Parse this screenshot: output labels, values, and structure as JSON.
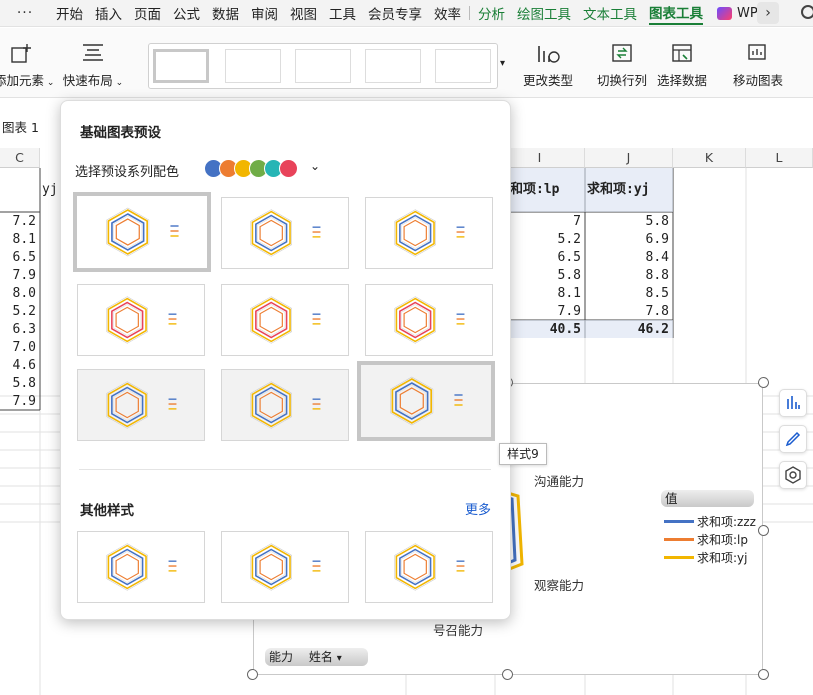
{
  "menubar": {
    "more": "···",
    "items": [
      "开始",
      "插入",
      "页面",
      "公式",
      "数据",
      "审阅",
      "视图",
      "工具",
      "会员专享",
      "效率"
    ],
    "context_items": [
      "分析",
      "绘图工具",
      "文本工具"
    ],
    "active": "图表工具",
    "wps": "WPS"
  },
  "ribbon": {
    "add_element": "添加元素",
    "quick_layout": "快速布局",
    "change_type": "更改类型",
    "switch_row_col": "切换行列",
    "select_data": "选择数据",
    "move_chart": "移动图表"
  },
  "namebox": "图表 1",
  "columns": [
    "C",
    "I",
    "J",
    "K",
    "L"
  ],
  "col_c_values": [
    "7.2",
    "8.1",
    "6.5",
    "7.9",
    "8.0",
    "5.2",
    "6.3",
    "7.0",
    "4.6",
    "5.8",
    "7.9"
  ],
  "partial_header": "yj",
  "pivot": {
    "header_i": "求和项:lp",
    "header_j": "求和项:yj",
    "col_i": [
      "7",
      "5.2",
      "6.5",
      "5.8",
      "8.1",
      "7.9"
    ],
    "col_j": [
      "5.8",
      "6.9",
      "8.4",
      "8.8",
      "8.5",
      "7.8"
    ],
    "total_i": "40.5",
    "total_j": "46.2"
  },
  "popup": {
    "title": "基础图表预设",
    "scheme_label": "选择预设系列配色",
    "scheme_colors": [
      "#4472c4",
      "#ed7d31",
      "#f2b600",
      "#70ad47",
      "#26b5b5",
      "#e8435a"
    ],
    "other_title": "其他样式",
    "more_link": "更多",
    "tooltip": "样式9"
  },
  "chart": {
    "legend_title": "值",
    "series": [
      {
        "name": "求和项:zzz",
        "color": "#4472c4"
      },
      {
        "name": "求和项:lp",
        "color": "#ed7d31"
      },
      {
        "name": "求和项:yj",
        "color": "#f2b600"
      }
    ],
    "axis_labels": {
      "a": "沟通能力",
      "b": "观察能力",
      "c": "号召能力"
    },
    "field_buttons": {
      "f1": "能力",
      "f2": "姓名"
    }
  }
}
